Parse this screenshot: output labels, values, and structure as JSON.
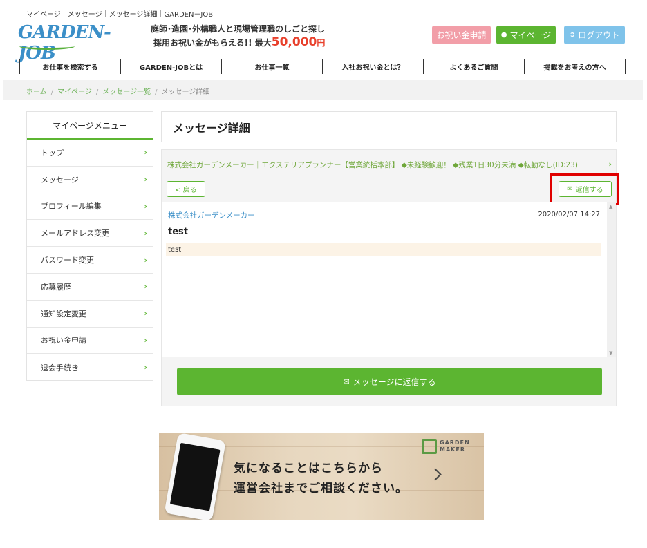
{
  "top_breadcrumb": "マイページ｜メッセージ｜メッセージ詳細｜GARDEN－JOB",
  "logo": {
    "text": "GARDEN-JOB"
  },
  "tagline": {
    "line1": "庭師･造園･外構職人と現場管理職のしごと探し",
    "line2_prefix": "採用お祝い金がもらえる!! 最大",
    "amount": "50,000",
    "yen": "円"
  },
  "header_buttons": {
    "celebration": "お祝い金申請",
    "mypage": "マイページ",
    "logout": "ログアウト"
  },
  "global_nav": [
    "お仕事を検索する",
    "GARDEN-JOBとは",
    "お仕事一覧",
    "入社お祝い金とは？",
    "よくあるご質問",
    "掲載をお考えの方へ"
  ],
  "breadcrumb": {
    "home": "ホーム",
    "mypage": "マイページ",
    "messages": "メッセージ一覧",
    "current": "メッセージ詳細",
    "separator": "/"
  },
  "sidebar": {
    "title": "マイページメニュー",
    "items": [
      "トップ",
      "メッセージ",
      "プロフィール編集",
      "メールアドレス変更",
      "パスワード変更",
      "応募履歴",
      "通知設定変更",
      "お祝い金申請",
      "退会手続き"
    ]
  },
  "page_title": "メッセージ詳細",
  "thread": {
    "subject": "株式会社ガーデンメーカー｜エクステリアプランナー【営業統括本部】 ◆未経験歓迎！ ◆残業1日30分未満 ◆転勤なし(ID:23)",
    "back_label": "< 戻る",
    "reply_label": "返信する",
    "message": {
      "sender": "株式会社ガーデンメーカー",
      "date": "2020/02/07 14:27",
      "title": "test",
      "body": "test"
    },
    "big_reply_label": "メッセージに返信する"
  },
  "banner": {
    "logo_line1": "GARDEN",
    "logo_line2": "MAKER",
    "text1": "気になることはこちらから",
    "text2": "運営会社までご相談ください。"
  },
  "colors": {
    "brand_green": "#5cb531",
    "link_blue": "#3b8fc8",
    "pink": "#f29ea8",
    "sky": "#7fc3ea",
    "highlight_red": "#e00000"
  }
}
